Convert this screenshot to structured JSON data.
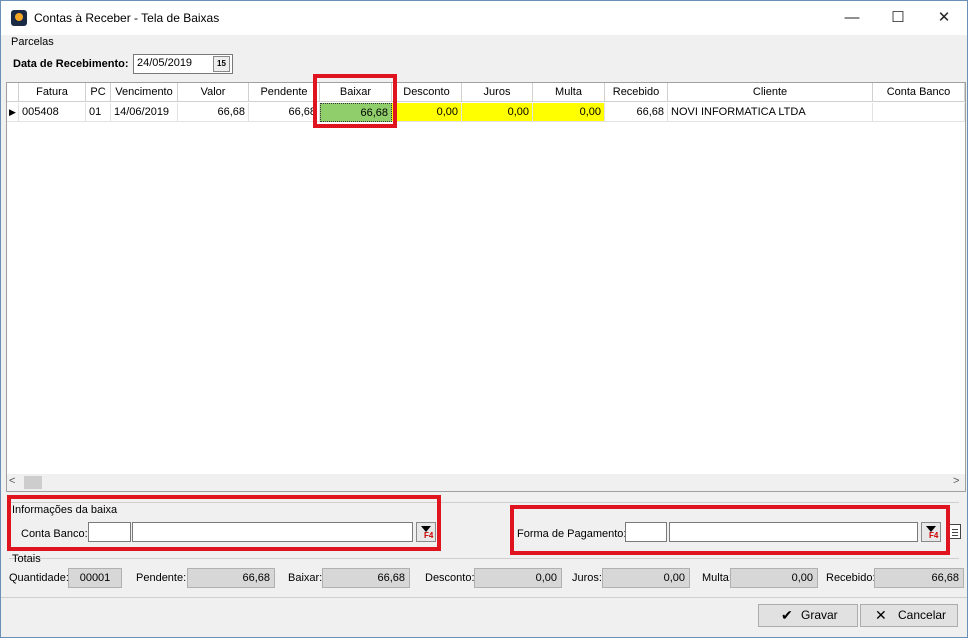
{
  "window": {
    "title": "Contas à Receber - Tela de Baixas",
    "min_glyph": "—",
    "max_glyph": "☐",
    "close_glyph": "✕"
  },
  "parcelas": {
    "group_label": "Parcelas",
    "date_label": "Data de Recebimento:",
    "date_value": "24/05/2019",
    "calendar_icon": "calendar-icon"
  },
  "grid": {
    "headers": [
      "Fatura",
      "PC",
      "Vencimento",
      "Valor",
      "Pendente",
      "Baixar",
      "Desconto",
      "Juros",
      "Multa",
      "Recebido",
      "Cliente",
      "Conta Banco"
    ],
    "rows": [
      {
        "indicator": "▶",
        "fatura": "005408",
        "pc": "01",
        "vencimento": "14/06/2019",
        "valor": "66,68",
        "pendente": "66,68",
        "baixar": "66,68",
        "desconto": "0,00",
        "juros": "0,00",
        "multa": "0,00",
        "recebido": "66,68",
        "cliente": "NOVI INFORMATICA LTDA",
        "conta_banco": ""
      }
    ],
    "scroll_left": "<",
    "scroll_right": ">"
  },
  "info": {
    "group_label": "Informações da baixa",
    "conta_banco_label": "Conta Banco:",
    "conta_banco_code": "",
    "conta_banco_name": "",
    "lookup_label": "F4"
  },
  "forma": {
    "label": "Forma de Pagamento:",
    "code": "",
    "name": "",
    "lookup_label": "F4"
  },
  "totais": {
    "group_label": "Totais",
    "quantidade_label": "Quantidade:",
    "quantidade": "00001",
    "pendente_label": "Pendente:",
    "pendente": "66,68",
    "baixar_label": "Baixar:",
    "baixar": "66,68",
    "desconto_label": "Desconto:",
    "desconto": "0,00",
    "juros_label": "Juros:",
    "juros": "0,00",
    "multa_label": "Multa:",
    "multa": "0,00",
    "recebido_label": "Recebido:",
    "recebido": "66,68"
  },
  "buttons": {
    "gravar_icon": "✔",
    "gravar_label": "Gravar",
    "cancelar_icon": "✕",
    "cancelar_label": "Cancelar"
  },
  "colors": {
    "highlight": "#e0141e",
    "yellow": "#ffff00",
    "green": "#8fce6a"
  }
}
